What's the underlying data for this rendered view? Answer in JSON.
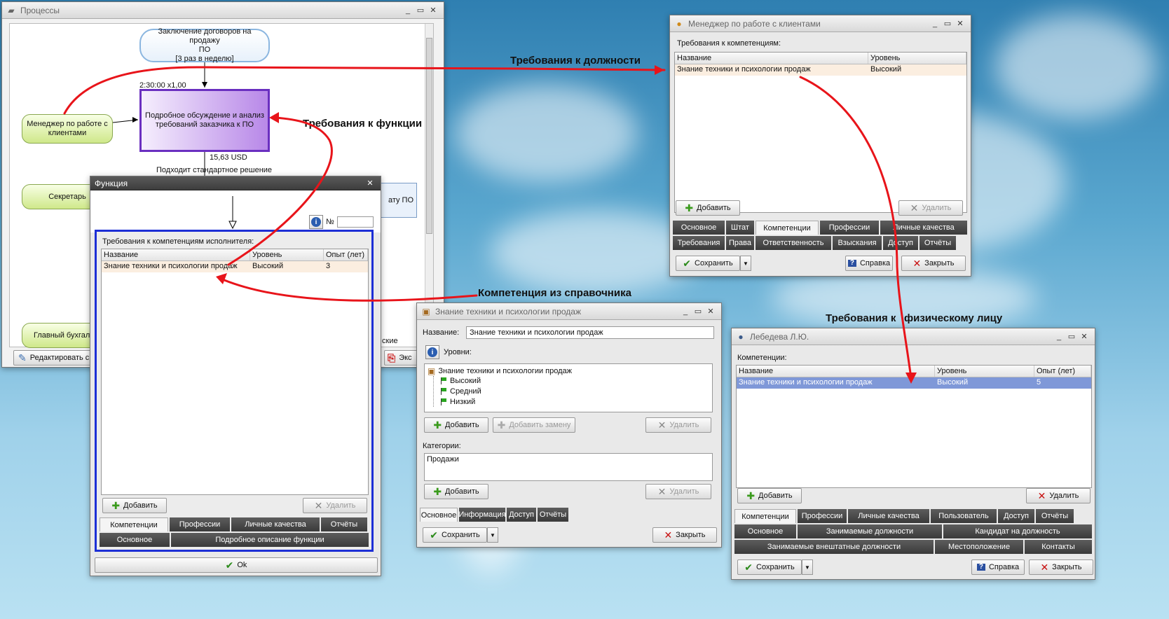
{
  "processes": {
    "title": "Процессы",
    "node_contract": "Заключение договоров на продажу ПО\n[3 раз в неделю]",
    "node_contract_l1": "Заключение договоров на продажу",
    "node_contract_l2": "ПО",
    "node_contract_l3": "[3 раз в неделю]",
    "time_label": "2:30:00 x1,00",
    "node_discuss_l1": "Подробное обсуждение и анализ",
    "node_discuss_l2": "требований заказчика к ПО",
    "cost_label": "15,63 USD",
    "node_manager_l1": "Менеджер по работе с",
    "node_manager_l2": "клиентами",
    "decision_label": "Подходит стандартное решение",
    "node_secretary": "Секретарь",
    "node_accountant": "Главный бухгалт",
    "node_right_partial": "ату ПО",
    "node_right_partial2": "ские",
    "edit_button": "Редактировать с",
    "export_button": "Экс"
  },
  "function_win": {
    "title": "Функция",
    "no_label": "№",
    "section_label": "Требования к компетенциям исполнителя:",
    "columns": [
      "Название",
      "Уровень",
      "Опыт (лет)"
    ],
    "rows": [
      [
        "Знание техники и психологии продаж",
        "Высокий",
        "3"
      ]
    ],
    "add": "Добавить",
    "delete": "Удалить",
    "tabs_row1": [
      "Компетенции",
      "Профессии",
      "Личные качества",
      "Отчёты"
    ],
    "tabs_row2": [
      "Основное",
      "Подробное описание функции"
    ],
    "ok": "Ok"
  },
  "manager_win": {
    "title": "Менеджер по работе с клиентами",
    "section_label": "Требования к компетенциям:",
    "columns": [
      "Название",
      "Уровень"
    ],
    "rows": [
      [
        "Знание техники и психологии продаж",
        "Высокий"
      ]
    ],
    "add": "Добавить",
    "delete": "Удалить",
    "tabs_row1": [
      "Основное",
      "Штат",
      "Компетенции",
      "Профессии",
      "Личные качества"
    ],
    "tabs_row2": [
      "Требования",
      "Права",
      "Ответственность",
      "Взыскания",
      "Доступ",
      "Отчёты"
    ],
    "save": "Сохранить",
    "help": "Справка",
    "close": "Закрыть"
  },
  "competence_win": {
    "title": "Знание техники и психологии продаж",
    "name_label": "Название:",
    "name_value": "Знание техники и психологии продаж",
    "levels_label": "Уровни:",
    "tree_root": "Знание техники и психологии продаж",
    "levels": [
      "Высокий",
      "Средний",
      "Низкий"
    ],
    "add": "Добавить",
    "add_replace": "Добавить замену",
    "delete": "Удалить",
    "categories_label": "Категории:",
    "categories": [
      "Продажи"
    ],
    "add2": "Добавить",
    "delete2": "Удалить",
    "tabs": [
      "Основное",
      "Информация",
      "Доступ",
      "Отчёты"
    ],
    "save": "Сохранить",
    "close": "Закрыть"
  },
  "person_win": {
    "title": "Лебедева Л.Ю.",
    "section_label": "Компетенции:",
    "columns": [
      "Название",
      "Уровень",
      "Опыт (лет)"
    ],
    "rows": [
      [
        "Знание техники и психологии продаж",
        "Высокий",
        "5"
      ]
    ],
    "add": "Добавить",
    "delete": "Удалить",
    "tabs_row1": [
      "Компетенции",
      "Профессии",
      "Личные качества",
      "Пользователь",
      "Доступ",
      "Отчёты"
    ],
    "tabs_row2": [
      "Основное",
      "Занимаемые должности",
      "Кандидат на должность"
    ],
    "tabs_row3": [
      "Занимаемые внештатные должности",
      "Местоположение",
      "Контакты"
    ],
    "save": "Сохранить",
    "help": "Справка",
    "close": "Закрыть"
  },
  "annotations": {
    "position_req": "Требования к должности",
    "function_req": "Требования к функции",
    "catalog_comp": "Компетенция из справочника",
    "person_req_a": "Требования к",
    "person_req_b": "физическому лицу"
  },
  "colors": {
    "arrow": "#e8141a",
    "selected_node": "#b07de0",
    "selection_border": "#1d2fd6",
    "row_highlight": "#fbeee0",
    "row_selected": "#7f98d8"
  }
}
